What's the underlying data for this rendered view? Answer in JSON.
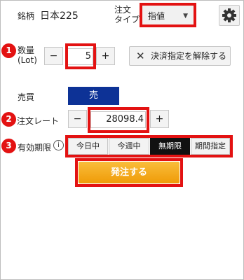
{
  "header": {
    "symbol_label": "銘柄",
    "symbol_name": "日本225",
    "order_type_label_line1": "注文",
    "order_type_label_line2": "タイプ",
    "order_type_value": "指値",
    "settings_icon": "gear-icon"
  },
  "quantity": {
    "badge": "1",
    "label_line1": "数量",
    "label_line2": "(Lot)",
    "minus": "−",
    "value": "5",
    "plus": "+"
  },
  "release_button": {
    "icon": "close-icon",
    "icon_glyph": "✕",
    "label": "決済指定を解除する"
  },
  "side": {
    "label": "売買",
    "value": "売"
  },
  "rate": {
    "badge": "2",
    "label": "注文レート",
    "minus": "−",
    "value": "28098.4",
    "plus": "+"
  },
  "expiry": {
    "badge": "3",
    "label": "有効期限",
    "info_glyph": "i",
    "options": [
      "今日中",
      "今週中",
      "無期限",
      "期間指定"
    ],
    "selected": "無期限"
  },
  "submit": {
    "label": "発注する"
  },
  "colors": {
    "highlight": "#e31212",
    "sell": "#0d3296",
    "submit": "#f4a61a"
  }
}
